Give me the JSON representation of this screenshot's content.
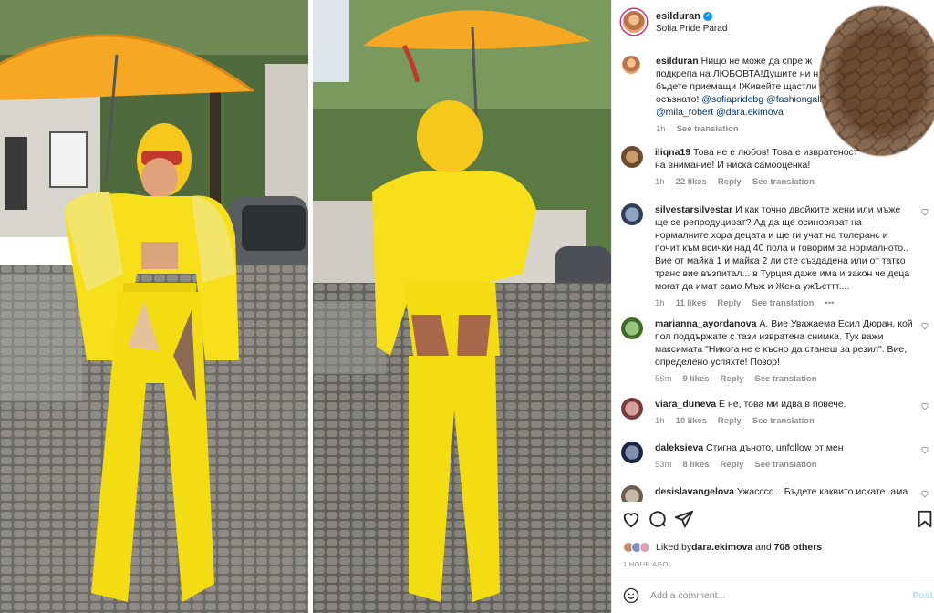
{
  "post": {
    "username": "esilduran",
    "location": "Sofia Pride Parad",
    "caption": {
      "username": "esilduran",
      "text": "Нищо не може да спре же... подкрепа на ЛЮБОВТА!Душите ни н... бъдете приемащи !Живейте щастли... осъзнато! @sofiapridebg @fashiongall...",
      "line1": "Нищо не може да спре ж",
      "line2": "подкрепа на ЛЮБОВТА!Душите ни н",
      "line3": "бъдете приемащи !Живейте щастли",
      "line4_text": "осъзнато! ",
      "mention1": "@sofiapridebg",
      "mention2": "@fashiongall",
      "mention3": "@mila_robert",
      "mention4": "@dara.ekimova",
      "time": "1h",
      "see_translation": "See translation"
    }
  },
  "comments": [
    {
      "username": "iliqna19",
      "text": "Това не е любов! Това е извратеност",
      "text2": "на внимание! И ниска самооценка!",
      "time": "1h",
      "likes": "22 likes",
      "reply": "Reply",
      "see_translation": "See translation"
    },
    {
      "username": "silvestarsilvestar",
      "text": "И как точно двойките жени или мъже ще се репродуцират? Ад да ще осиновяват на нормалните хора децата и ще ги учат на толеранс и почит към всички над 40 пола и говорим за нормалното.. Вие от майка 1 и майка 2 ли сте създадена или от татко транс вие възпитал... в Турция даже има и закон че деца могат да имат само Мъж и Жена ужЪсттт....",
      "time": "1h",
      "likes": "11 likes",
      "reply": "Reply",
      "see_translation": "See translation",
      "more": "•••"
    },
    {
      "username": "marianna_ayordanova",
      "text": "А. Вие Уважаема Есил Дюран, кой пол поддържате с тази извратена снимка. Тук важи максимата \"Никога не е късно да станеш за резил\". Вие, определено успяхте! Позор!",
      "time": "56m",
      "likes": "9 likes",
      "reply": "Reply",
      "see_translation": "See translation"
    },
    {
      "username": "viara_duneva",
      "text": "Е не, това ми идва в повече.",
      "time": "1h",
      "likes": "10 likes",
      "reply": "Reply",
      "see_translation": "See translation"
    },
    {
      "username": "daleksieva",
      "text": "Стигна дъното, unfollow от мен",
      "time": "53m",
      "likes": "8 likes",
      "reply": "Reply",
      "see_translation": "See translation"
    },
    {
      "username": "desislavangelova",
      "text": "Ужасссс... Бъдете каквито искате .ама"
    }
  ],
  "likes": {
    "prefix": "Liked by ",
    "user": "dara.ekimova",
    "and": " and ",
    "others": "708 others"
  },
  "timestamp": "1 HOUR AGO",
  "add_comment": {
    "placeholder": "Add a comment...",
    "post_label": "Post"
  },
  "icons": {
    "like": "heart-icon",
    "comment": "comment-icon",
    "share": "send-icon",
    "save": "bookmark-icon",
    "emoji": "emoji-icon",
    "verified": "verified-badge-icon"
  },
  "colors": {
    "link": "#00376b",
    "verified": "#0095f6",
    "muted": "#8e8e8e",
    "outfit_yellow": "#f7e01a",
    "umbrella_orange": "#f6a723"
  }
}
